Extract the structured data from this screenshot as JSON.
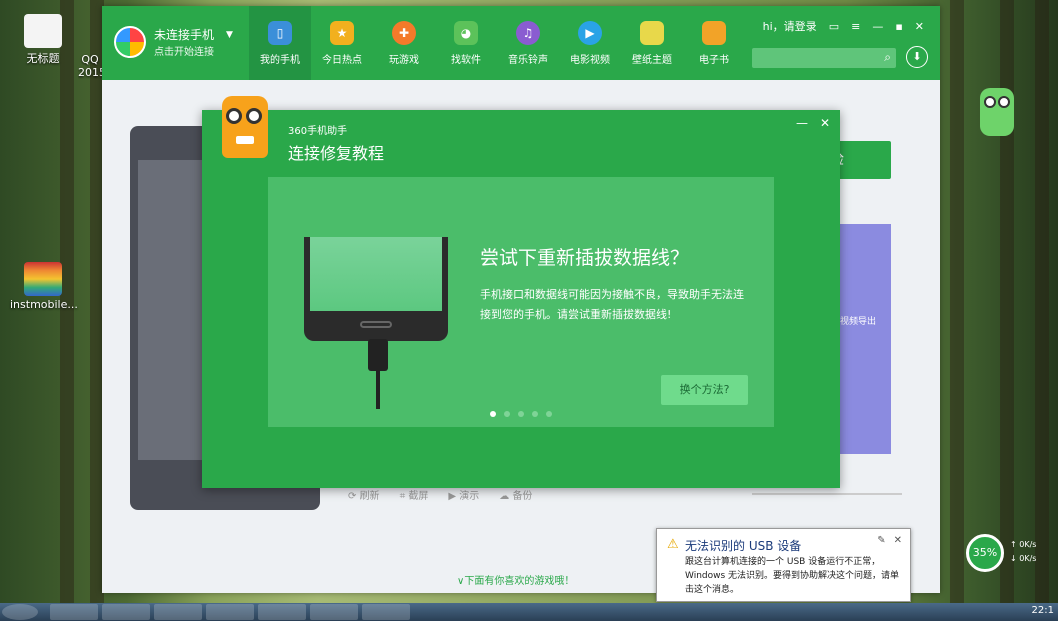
{
  "desktop": {
    "icons": [
      {
        "label": "无标题"
      },
      {
        "label": "QQ\n2015"
      },
      {
        "label": "instmobile..."
      }
    ]
  },
  "app": {
    "brand": {
      "line1": "未连接手机",
      "line2": "点击开始连接"
    },
    "nav": [
      {
        "label": "我的手机",
        "icon": "phone-icon",
        "color": "#3b8fd9"
      },
      {
        "label": "今日热点",
        "icon": "star-icon",
        "color": "#f2b01e"
      },
      {
        "label": "玩游戏",
        "icon": "gamepad-icon",
        "color": "#f47a2a"
      },
      {
        "label": "找软件",
        "icon": "android-icon",
        "color": "#5cc25a"
      },
      {
        "label": "音乐铃声",
        "icon": "music-icon",
        "color": "#8a5cd1"
      },
      {
        "label": "电影视频",
        "icon": "play-icon",
        "color": "#2aa3e6"
      },
      {
        "label": "壁纸主题",
        "icon": "wallpaper-icon",
        "color": "#e8d84a"
      },
      {
        "label": "电子书",
        "icon": "book-icon",
        "color": "#f2a328"
      }
    ],
    "login": "hi，请登录",
    "search_placeholder": "",
    "bg_button": "体检",
    "bg_panel_text": "视频导出",
    "toolbar": [
      "刷新",
      "截屏",
      "演示",
      "备份"
    ],
    "bottom_hint": "下面有你喜欢的游戏哦！"
  },
  "modal": {
    "subtitle": "360手机助手",
    "title": "连接修复教程",
    "heading": "尝试下重新插拔数据线？",
    "body": "手机接口和数据线可能因为接触不良，导致助手无法连接到您的手机。请尝试重新插拔数据线!",
    "alt_button": "换个方法?",
    "dots": 5,
    "active_dot": 0
  },
  "balloon": {
    "title": "无法识别的 USB 设备",
    "body": "跟这台计算机连接的一个 USB 设备运行不正常，Windows 无法识别。要得到协助解决这个问题，请单击这个消息。"
  },
  "net_meter": {
    "percent": "35%",
    "up": "0K/s",
    "down": "0K/s"
  },
  "taskbar": {
    "clock": "22:1"
  }
}
